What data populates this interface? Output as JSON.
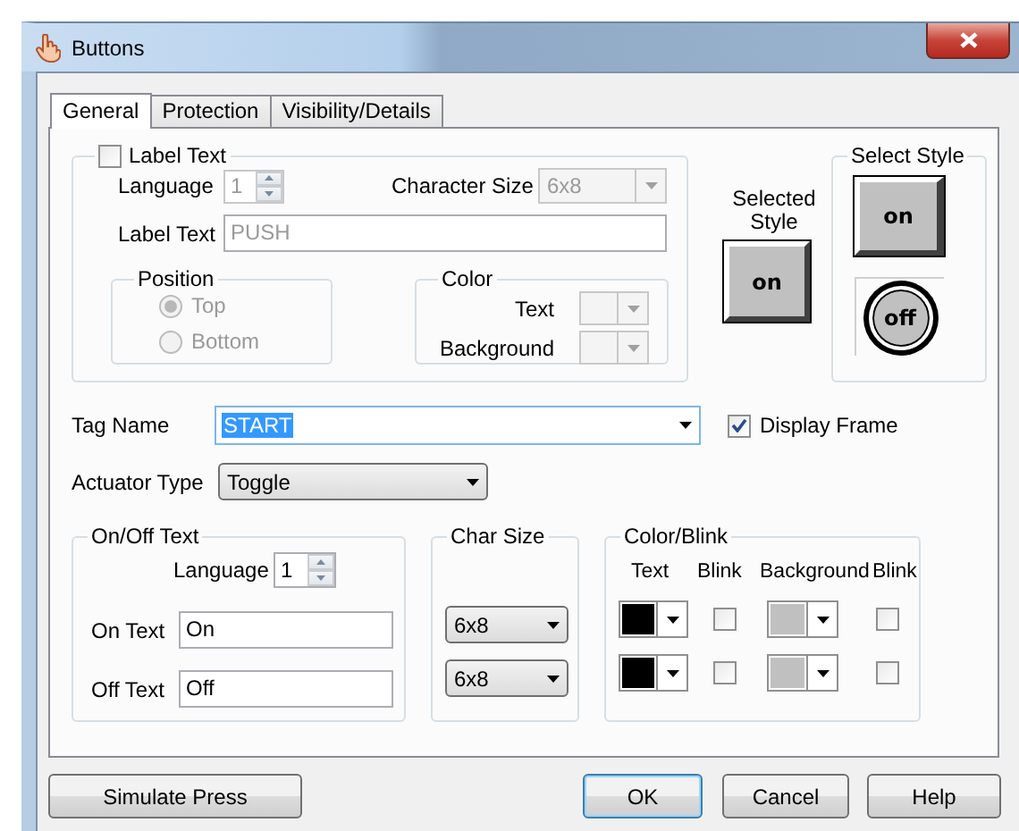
{
  "window": {
    "title": "Buttons"
  },
  "tabs": [
    {
      "label": "General",
      "selected": true
    },
    {
      "label": "Protection",
      "selected": false
    },
    {
      "label": "Visibility/Details",
      "selected": false
    }
  ],
  "label_text": {
    "label": "Label Text",
    "checked": false,
    "language_label": "Language",
    "language": "1",
    "character_size_label": "Character Size",
    "character_size": "6x8",
    "text_label": "Label Text",
    "text": "PUSH",
    "position": {
      "title": "Position",
      "options": [
        {
          "label": "Top",
          "selected": true
        },
        {
          "label": "Bottom",
          "selected": false
        }
      ]
    },
    "color": {
      "title": "Color",
      "text_label": "Text",
      "background_label": "Background"
    }
  },
  "selected_style": {
    "label": "Selected Style",
    "button_text": "on"
  },
  "select_style": {
    "title": "Select Style",
    "styles": [
      {
        "kind": "square",
        "text": "on"
      },
      {
        "kind": "round",
        "text": "off"
      }
    ]
  },
  "tag_name": {
    "label": "Tag Name",
    "value": "START",
    "highlighted": true
  },
  "display_frame": {
    "label": "Display Frame",
    "checked": true
  },
  "actuator_type": {
    "label": "Actuator Type",
    "value": "Toggle"
  },
  "on_off_text": {
    "title": "On/Off Text",
    "language_label": "Language",
    "language": "1",
    "rows": [
      {
        "label": "On Text",
        "value": "On"
      },
      {
        "label": "Off Text",
        "value": "Off"
      }
    ]
  },
  "char_size": {
    "title": "Char Size",
    "values": [
      "6x8",
      "6x8"
    ]
  },
  "color_blink": {
    "title": "Color/Blink",
    "columns": [
      "Text",
      "Blink",
      "Background",
      "Blink"
    ],
    "rows": [
      {
        "text": {
          "color": "#000000",
          "blink": false
        },
        "background": {
          "color": "#c0c0c0",
          "blink": false
        }
      },
      {
        "text": {
          "color": "#000000",
          "blink": false
        },
        "background": {
          "color": "#c0c0c0",
          "blink": false
        }
      }
    ]
  },
  "buttons": [
    {
      "label": "Simulate Press",
      "default": false
    },
    {
      "label": "OK",
      "default": true
    },
    {
      "label": "Cancel",
      "default": false
    },
    {
      "label": "Help",
      "default": false
    }
  ]
}
